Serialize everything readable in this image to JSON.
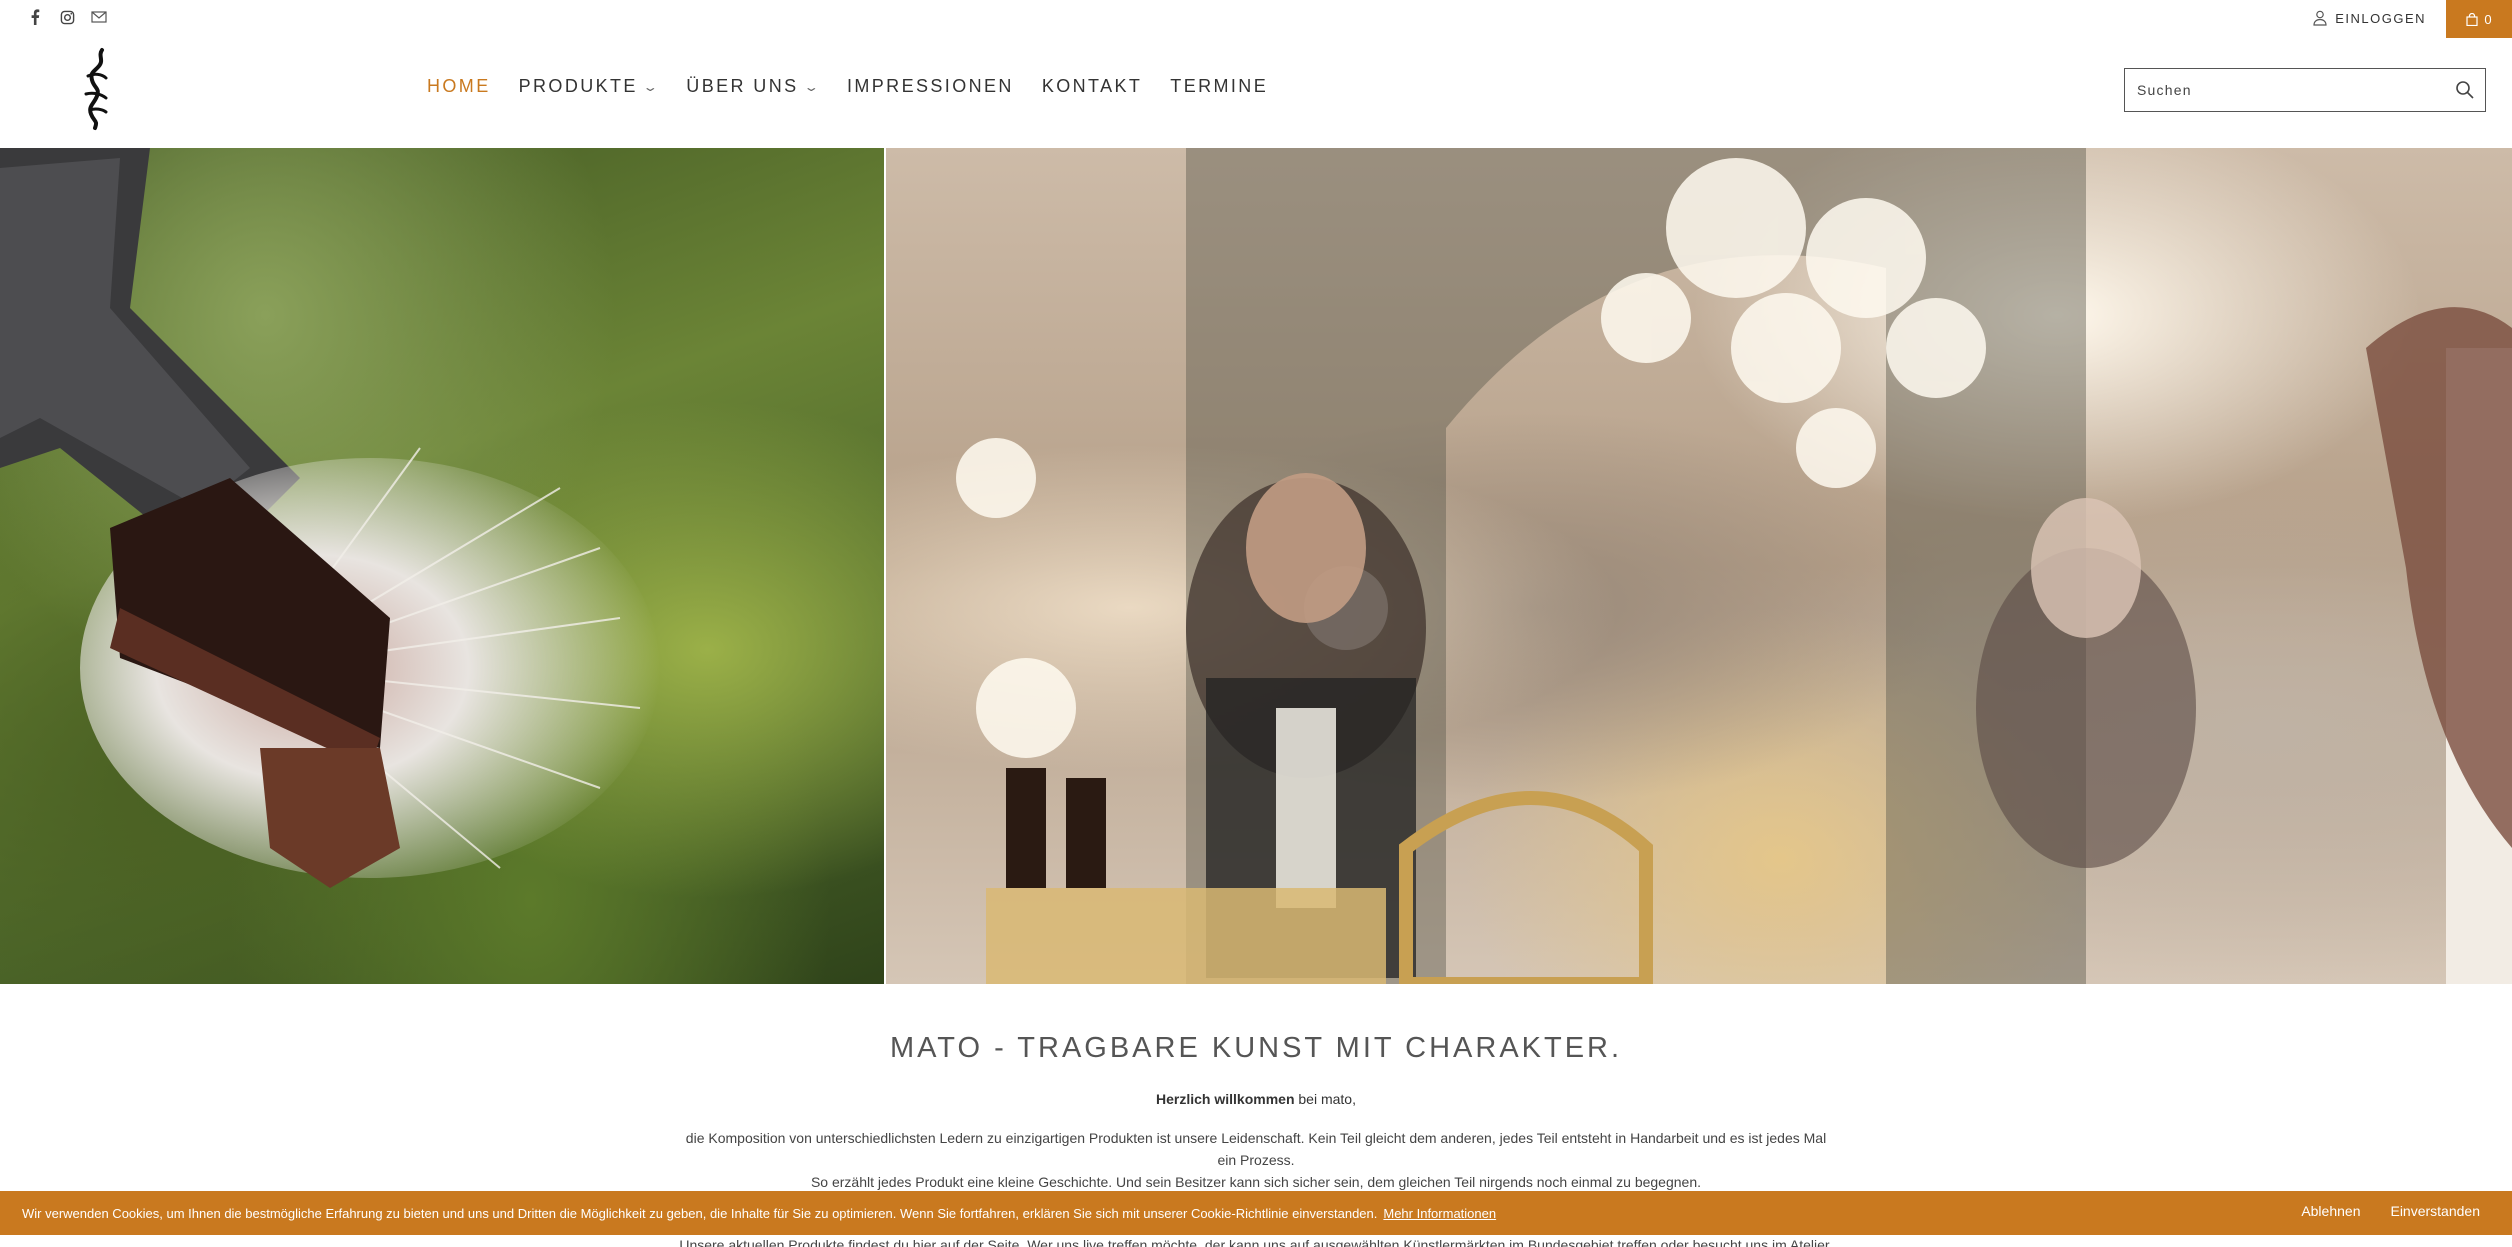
{
  "topbar": {
    "social_icons": [
      "facebook-icon",
      "instagram-icon",
      "mail-icon"
    ],
    "login_label": "EINLOGGEN",
    "cart_count": "0"
  },
  "nav": {
    "items": [
      {
        "label": "HOME",
        "active": true
      },
      {
        "label": "PRODUKTE",
        "dropdown": true
      },
      {
        "label": "ÜBER UNS",
        "dropdown": true
      },
      {
        "label": "IMPRESSIONEN"
      },
      {
        "label": "KONTAKT"
      },
      {
        "label": "TERMINE"
      }
    ]
  },
  "search": {
    "placeholder": "Suchen"
  },
  "content": {
    "headline": "MATO - TRAGBARE KUNST MIT CHARAKTER.",
    "welcome_bold": "Herzlich willkommen",
    "welcome_rest": " bei mato,",
    "paragraph_1": "die Komposition von unterschiedlichsten Ledern zu einzigartigen Produkten ist unsere Leidenschaft. Kein Teil gleicht dem anderen, jedes Teil entsteht in Handarbeit und es ist jedes Mal ein Prozess.",
    "paragraph_2": "So erzählt jedes Produkt eine kleine Geschichte. Und sein Besitzer kann sich sicher sein, dem gleichen Teil nirgends noch einmal zu begegnen.",
    "paragraph_3": "Unsere aktuellen Produkte findest du hier auf der Seite. Wer uns live treffen möchte, der kann uns auf ausgewählten Künstlermärkten im Bundesgebiet treffen oder besucht uns im Atelier."
  },
  "cookie": {
    "text": "Wir verwenden Cookies, um Ihnen die bestmögliche Erfahrung zu bieten und uns und Dritten die Möglichkeit zu geben, die Inhalte für Sie zu optimieren. Wenn Sie fortfahren, erklären Sie sich mit unserer Cookie-Richtlinie einverstanden.",
    "more_label": "Mehr Informationen",
    "decline_label": "Ablehnen",
    "accept_label": "Einverstanden"
  },
  "colors": {
    "accent": "#c9791f"
  }
}
